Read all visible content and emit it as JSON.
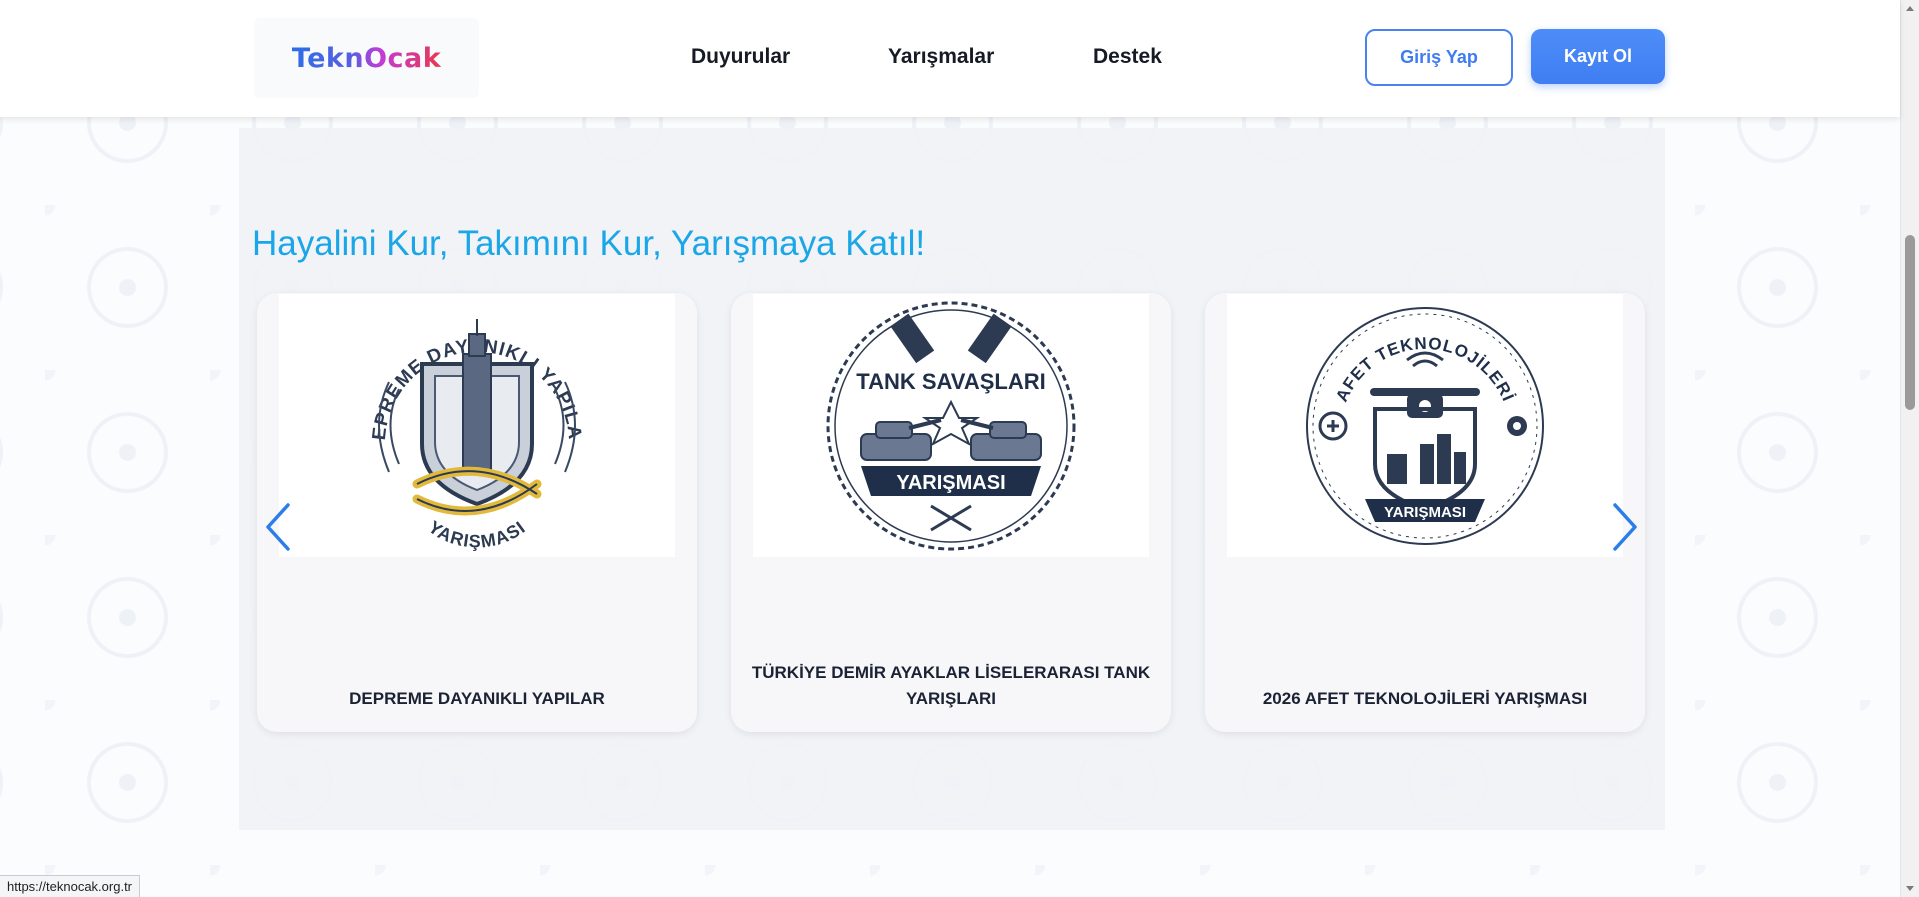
{
  "header": {
    "logo_text": "TeknOcak",
    "nav": [
      {
        "label": "Duyurular"
      },
      {
        "label": "Yarışmalar"
      },
      {
        "label": "Destek"
      }
    ],
    "login_label": "Giriş Yap",
    "register_label": "Kayıt Ol"
  },
  "main": {
    "title": "Hayalini Kur, Takımını Kur, Yarışmaya Katıl!",
    "cards": [
      {
        "badge_top": "DEPREME DAYANIKLI YAPILAR",
        "badge_bottom": "YARIŞMASI",
        "title": "DEPREME DAYANIKLI YAPILAR"
      },
      {
        "badge_top": "TANK SAVAŞLARI",
        "badge_bottom": "YARIŞMASI",
        "title": "TÜRKİYE DEMİR AYAKLAR LİSELERARASI TANK YARIŞLARI"
      },
      {
        "badge_top": "AFET TEKNOLOJİLERİ",
        "badge_bottom": "YARIŞMASI",
        "title": "2026 AFET TEKNOLOJİLERİ YARIŞMASI"
      }
    ]
  },
  "status_bar": {
    "url": "https://teknocak.org.tr"
  },
  "colors": {
    "accent": "#1ba6e8",
    "primary_button": "#4285f4",
    "badge_navy": "#1f2f4a",
    "badge_gold": "#e2b93b"
  },
  "icons": [
    "chevron-left-icon",
    "chevron-right-icon"
  ]
}
